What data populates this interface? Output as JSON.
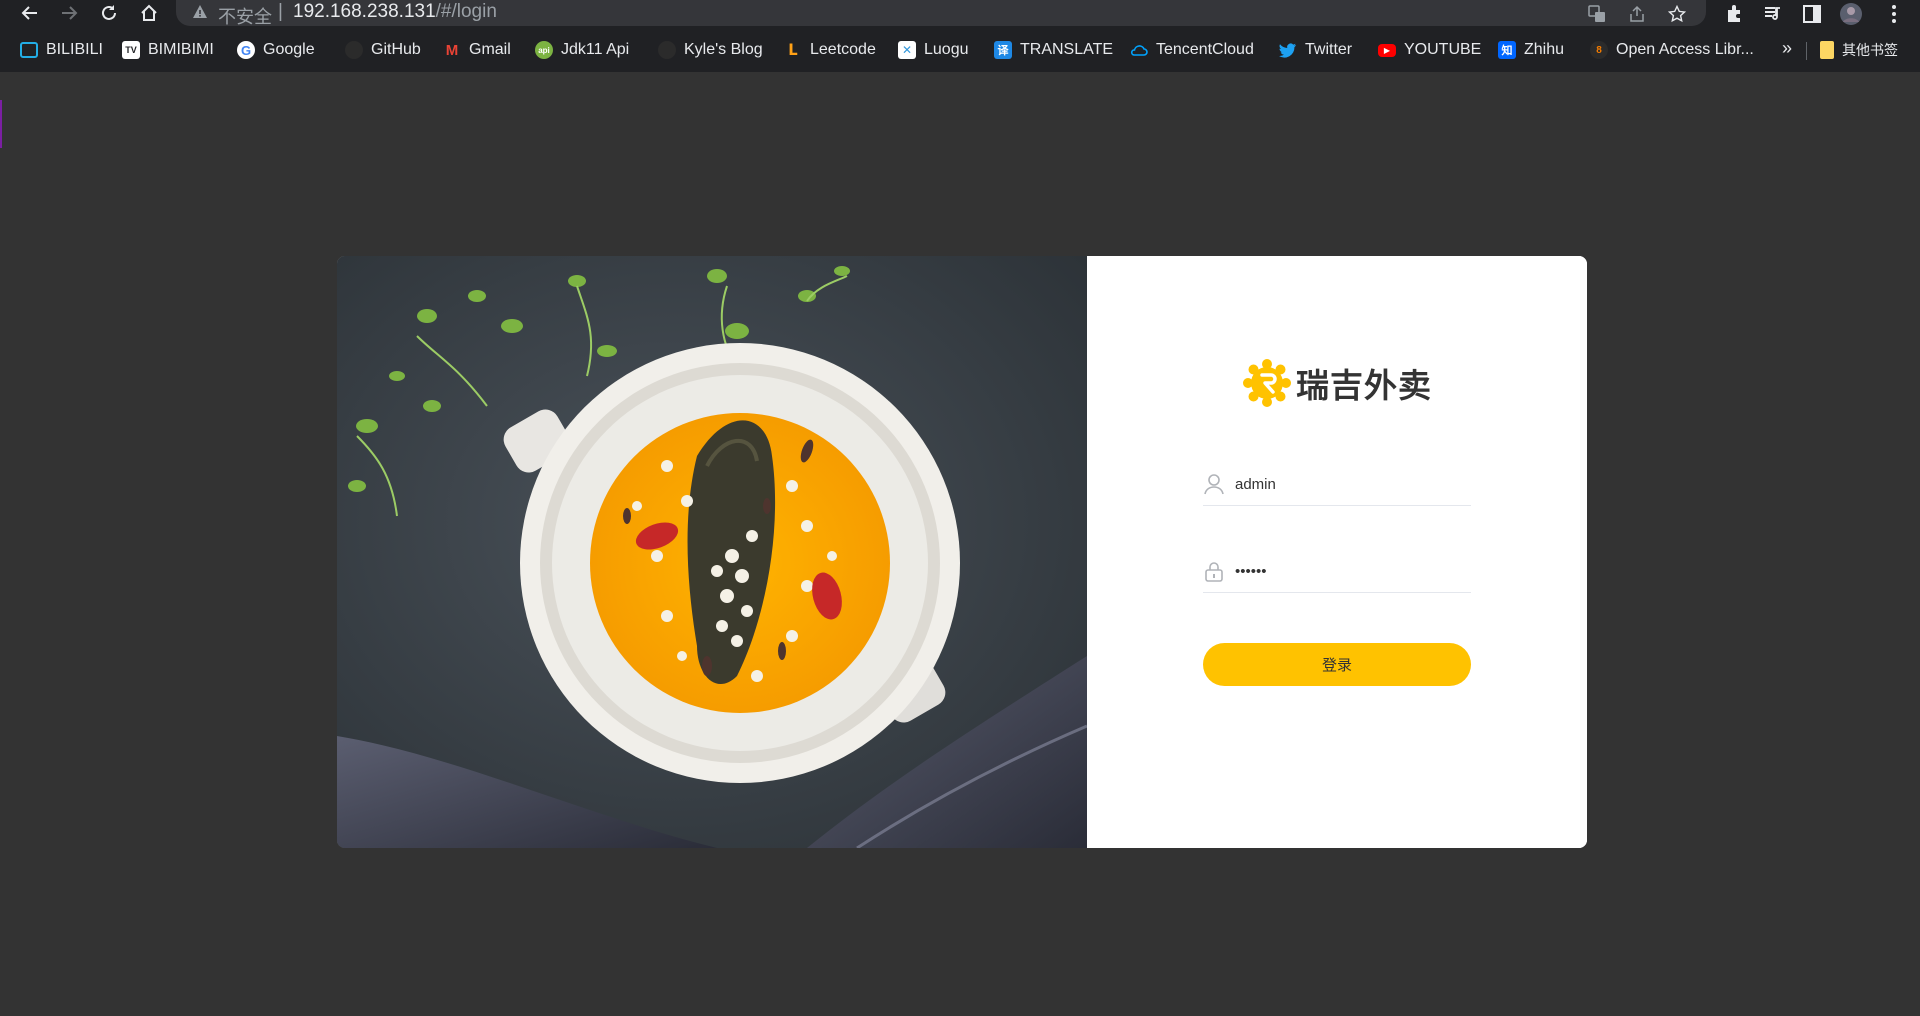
{
  "browser": {
    "omnibox": {
      "security_label": "不安全",
      "separator": "|",
      "url_host": "192.168.238.131",
      "url_path": "/#/login"
    },
    "nav_icons": [
      "back-arrow-icon",
      "forward-arrow-icon",
      "reload-icon",
      "home-icon"
    ],
    "toolbar_icons": [
      "translate-icon",
      "share-icon",
      "star-icon",
      "extensions-icon",
      "media-icon",
      "sidepanel-icon",
      "profile-avatar",
      "menu-icon"
    ]
  },
  "bookmarks": {
    "items": [
      {
        "label": "BILIBILI",
        "icon": "bilibili-icon",
        "color": "#23ade5"
      },
      {
        "label": "BIMIBIMI",
        "icon": "bimibimi-icon",
        "color": "#ffffff"
      },
      {
        "label": "Google",
        "icon": "google-icon",
        "color": "#4285f4"
      },
      {
        "label": "GitHub",
        "icon": "github-icon",
        "color": "#24292e"
      },
      {
        "label": "Gmail",
        "icon": "gmail-icon",
        "color": "#ea4335"
      },
      {
        "label": "Jdk11 Api",
        "icon": "java-icon",
        "color": "#7cb342"
      },
      {
        "label": "Kyle's Blog",
        "icon": "blog-icon",
        "color": "#333333"
      },
      {
        "label": "Leetcode",
        "icon": "leetcode-icon",
        "color": "#ffa116"
      },
      {
        "label": "Luogu",
        "icon": "luogu-icon",
        "color": "#3498db"
      },
      {
        "label": "TRANSLATE",
        "icon": "translate-icon",
        "color": "#1e88e5"
      },
      {
        "label": "TencentCloud",
        "icon": "cloud-icon",
        "color": "#00a4ff"
      },
      {
        "label": "Twitter",
        "icon": "twitter-icon",
        "color": "#1da1f2"
      },
      {
        "label": "YOUTUBE",
        "icon": "youtube-icon",
        "color": "#ff0000"
      },
      {
        "label": "Zhihu",
        "icon": "zhihu-icon",
        "color": "#0066ff"
      },
      {
        "label": "Open Access Libr...",
        "icon": "openaccess-icon",
        "color": "#f57c00"
      }
    ],
    "more_label": "»",
    "other_folder_label": "其他书签"
  },
  "login": {
    "brand_name": "瑞吉外卖",
    "brand_color": "#ffc200",
    "username_value": "admin",
    "password_value": "123456",
    "submit_label": "登录"
  },
  "colors": {
    "page_background": "#333333",
    "accent": "#ffc200"
  }
}
